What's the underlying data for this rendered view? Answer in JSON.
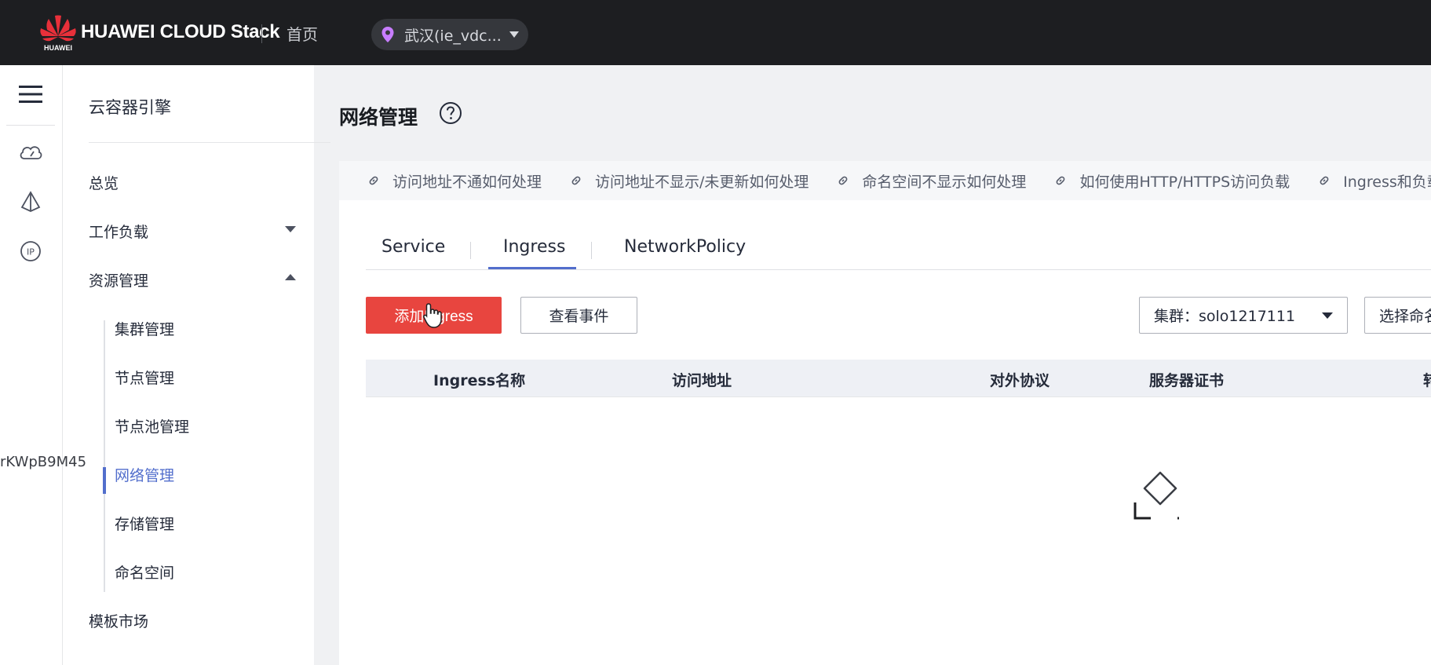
{
  "topbar": {
    "brand": "HUAWEI CLOUD Stack",
    "logo_text": "HUAWEI",
    "home_label": "首页",
    "region_label": "武汉(ie_vdc..."
  },
  "rail": {
    "icons": [
      "menu-icon",
      "cloud-gauge-icon",
      "network-topology-icon",
      "ip-icon"
    ]
  },
  "sidebar": {
    "title": "云容器引擎",
    "items": [
      {
        "label": "总览"
      },
      {
        "label": "工作负载"
      },
      {
        "label": "资源管理"
      },
      {
        "label": "模板市场"
      }
    ],
    "sub_items": [
      {
        "label": "集群管理"
      },
      {
        "label": "节点管理"
      },
      {
        "label": "节点池管理"
      },
      {
        "label": "网络管理"
      },
      {
        "label": "存储管理"
      },
      {
        "label": "命名空间"
      }
    ],
    "active_sub": "网络管理"
  },
  "overlay_text": "rKWpB9M45",
  "main": {
    "title": "网络管理",
    "help_links": [
      "访问地址不通如何处理",
      "访问地址不显示/未更新如何处理",
      "命名空间不显示如何处理",
      "如何使用HTTP/HTTPS访问负载",
      "Ingress和负载均"
    ],
    "tabs": [
      {
        "label": "Service"
      },
      {
        "label": "Ingress"
      },
      {
        "label": "NetworkPolicy"
      }
    ],
    "active_tab": "Ingress",
    "add_button": "添加Ingress",
    "events_button": "查看事件",
    "cluster_select": "集群：solo1217111",
    "namespace_select": "选择命名",
    "table_headers": [
      "Ingress名称",
      "访问地址",
      "对外协议",
      "服务器证书",
      "转"
    ]
  },
  "colors": {
    "accent": "#526ecc",
    "primary_button": "#e8453f",
    "topbar": "#1d1e21"
  }
}
